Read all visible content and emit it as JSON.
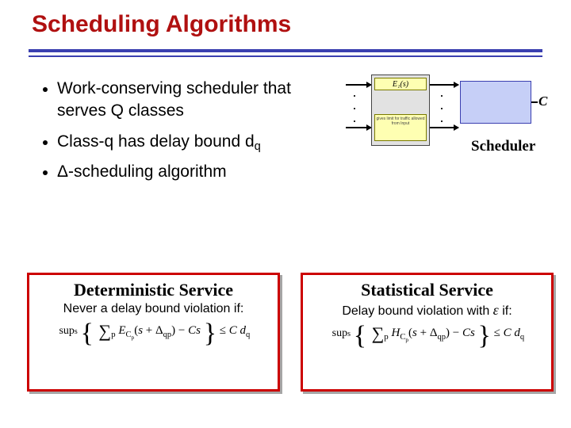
{
  "title": "Scheduling Algorithms",
  "bullets": {
    "b1": "Work-conserving scheduler that serves Q classes",
    "b2_pre": "Class-q has delay bound d",
    "b2_sub": "q",
    "b3_pre": "Δ-scheduling algorithm"
  },
  "diagram": {
    "env_top": "E₁(s)",
    "scheduler": "Scheduler",
    "capacity": "C",
    "q_bot_text": "gives limit for traffic allowed from Input"
  },
  "panels": {
    "left": {
      "title": "Deterministic Service",
      "subtitle": "Never a delay bound violation if:",
      "formula_plain": "supₛ { Σₚ E_Cₚ(s + Δ_qp) − Cs } ≤ C d_q"
    },
    "right": {
      "title": "Statistical Service",
      "subtitle_pre": "Delay bound violation with ",
      "subtitle_eps": "ε",
      "subtitle_post": " if:",
      "formula_plain": "supₛ { Σₚ H_Cₚ(s + Δ_qp) − Cs } ≤ C d_q"
    }
  }
}
